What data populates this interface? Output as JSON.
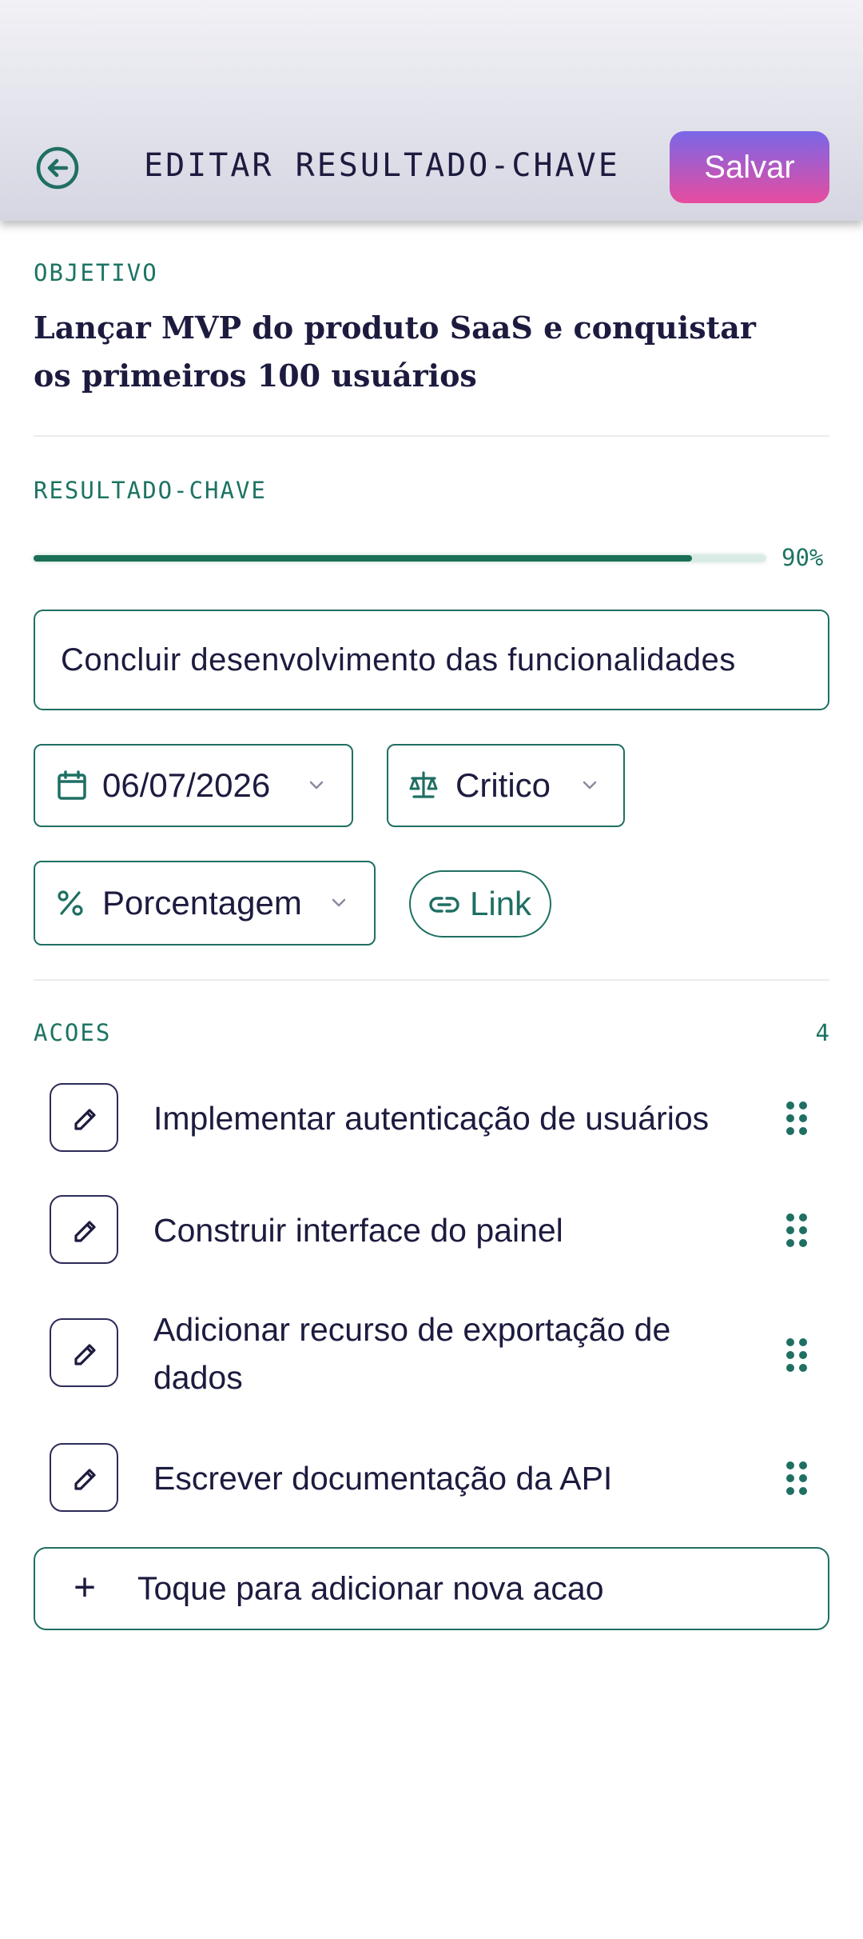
{
  "header": {
    "title": "EDITAR RESULTADO-CHAVE",
    "save_label": "Salvar"
  },
  "objective": {
    "label": "OBJETIVO",
    "text": "Lançar MVP do produto SaaS e conquistar os primeiros 100 usuários"
  },
  "key_result": {
    "label": "RESULTADO-CHAVE",
    "progress_fraction": 0.9,
    "progress_text": "90%",
    "value": "Concluir desenvolvimento das funcionalidades"
  },
  "fields": {
    "date": "06/07/2026",
    "priority": "Critico",
    "measure_type": "Porcentagem",
    "link_label": "Link"
  },
  "actions": {
    "label": "ACOES",
    "count": "4",
    "items": [
      "Implementar autenticação de usuários",
      "Construir interface do painel",
      "Adicionar recurso de exportação de dados",
      "Escrever documentação da API"
    ],
    "add_label": "Toque para adicionar nova acao"
  },
  "icons": {
    "back": "arrow-left-circle-icon",
    "date": "calendar-icon",
    "priority": "scale-icon",
    "measure": "percent-icon",
    "link": "link-icon",
    "edit": "pencil-icon",
    "drag": "drag-handle-icon",
    "add": "plus-icon"
  },
  "colors": {
    "accent": "#1f6f63",
    "text": "#1c1b3f",
    "save_gradient_top": "#7a67e8",
    "save_gradient_bottom": "#e74c9f"
  }
}
